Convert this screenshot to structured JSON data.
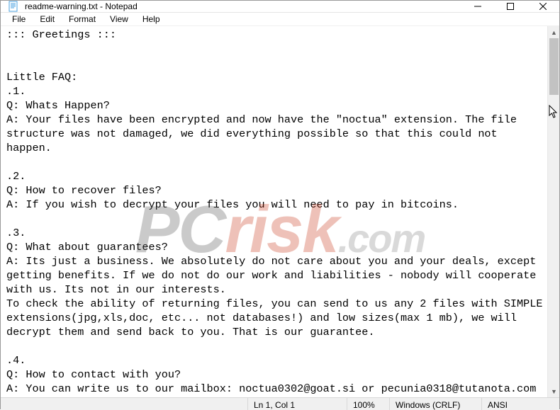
{
  "window": {
    "title": "readme-warning.txt - Notepad"
  },
  "menu": {
    "file": "File",
    "edit": "Edit",
    "format": "Format",
    "view": "View",
    "help": "Help"
  },
  "document": {
    "text": "::: Greetings :::\n\n\nLittle FAQ:\n.1.\nQ: Whats Happen?\nA: Your files have been encrypted and now have the \"noctua\" extension. The file structure was not damaged, we did everything possible so that this could not happen.\n\n.2.\nQ: How to recover files?\nA: If you wish to decrypt your files you will need to pay in bitcoins.\n\n.3.\nQ: What about guarantees?\nA: Its just a business. We absolutely do not care about you and your deals, except getting benefits. If we do not do our work and liabilities - nobody will cooperate with us. Its not in our interests.\nTo check the ability of returning files, you can send to us any 2 files with SIMPLE extensions(jpg,xls,doc, etc... not databases!) and low sizes(max 1 mb), we will decrypt them and send back to you. That is our guarantee.\n\n.4.\nQ: How to contact with you?\nA: You can write us to our mailbox: noctua0302@goat.si or pecunia0318@tutanota.com"
  },
  "statusbar": {
    "position": "Ln 1, Col 1",
    "zoom": "100%",
    "line_ending": "Windows (CRLF)",
    "encoding": "ANSI"
  },
  "watermark": {
    "pc": "PC",
    "risk": "risk",
    "com": ".com"
  }
}
